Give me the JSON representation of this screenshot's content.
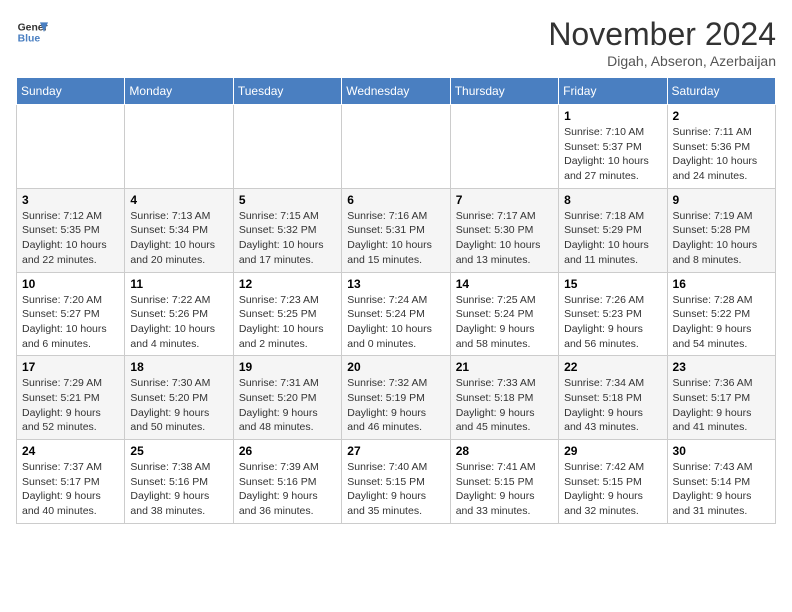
{
  "header": {
    "logo_line1": "General",
    "logo_line2": "Blue",
    "month": "November 2024",
    "location": "Digah, Abseron, Azerbaijan"
  },
  "weekdays": [
    "Sunday",
    "Monday",
    "Tuesday",
    "Wednesday",
    "Thursday",
    "Friday",
    "Saturday"
  ],
  "weeks": [
    [
      {
        "day": "",
        "info": ""
      },
      {
        "day": "",
        "info": ""
      },
      {
        "day": "",
        "info": ""
      },
      {
        "day": "",
        "info": ""
      },
      {
        "day": "",
        "info": ""
      },
      {
        "day": "1",
        "info": "Sunrise: 7:10 AM\nSunset: 5:37 PM\nDaylight: 10 hours and 27 minutes."
      },
      {
        "day": "2",
        "info": "Sunrise: 7:11 AM\nSunset: 5:36 PM\nDaylight: 10 hours and 24 minutes."
      }
    ],
    [
      {
        "day": "3",
        "info": "Sunrise: 7:12 AM\nSunset: 5:35 PM\nDaylight: 10 hours and 22 minutes."
      },
      {
        "day": "4",
        "info": "Sunrise: 7:13 AM\nSunset: 5:34 PM\nDaylight: 10 hours and 20 minutes."
      },
      {
        "day": "5",
        "info": "Sunrise: 7:15 AM\nSunset: 5:32 PM\nDaylight: 10 hours and 17 minutes."
      },
      {
        "day": "6",
        "info": "Sunrise: 7:16 AM\nSunset: 5:31 PM\nDaylight: 10 hours and 15 minutes."
      },
      {
        "day": "7",
        "info": "Sunrise: 7:17 AM\nSunset: 5:30 PM\nDaylight: 10 hours and 13 minutes."
      },
      {
        "day": "8",
        "info": "Sunrise: 7:18 AM\nSunset: 5:29 PM\nDaylight: 10 hours and 11 minutes."
      },
      {
        "day": "9",
        "info": "Sunrise: 7:19 AM\nSunset: 5:28 PM\nDaylight: 10 hours and 8 minutes."
      }
    ],
    [
      {
        "day": "10",
        "info": "Sunrise: 7:20 AM\nSunset: 5:27 PM\nDaylight: 10 hours and 6 minutes."
      },
      {
        "day": "11",
        "info": "Sunrise: 7:22 AM\nSunset: 5:26 PM\nDaylight: 10 hours and 4 minutes."
      },
      {
        "day": "12",
        "info": "Sunrise: 7:23 AM\nSunset: 5:25 PM\nDaylight: 10 hours and 2 minutes."
      },
      {
        "day": "13",
        "info": "Sunrise: 7:24 AM\nSunset: 5:24 PM\nDaylight: 10 hours and 0 minutes."
      },
      {
        "day": "14",
        "info": "Sunrise: 7:25 AM\nSunset: 5:24 PM\nDaylight: 9 hours and 58 minutes."
      },
      {
        "day": "15",
        "info": "Sunrise: 7:26 AM\nSunset: 5:23 PM\nDaylight: 9 hours and 56 minutes."
      },
      {
        "day": "16",
        "info": "Sunrise: 7:28 AM\nSunset: 5:22 PM\nDaylight: 9 hours and 54 minutes."
      }
    ],
    [
      {
        "day": "17",
        "info": "Sunrise: 7:29 AM\nSunset: 5:21 PM\nDaylight: 9 hours and 52 minutes."
      },
      {
        "day": "18",
        "info": "Sunrise: 7:30 AM\nSunset: 5:20 PM\nDaylight: 9 hours and 50 minutes."
      },
      {
        "day": "19",
        "info": "Sunrise: 7:31 AM\nSunset: 5:20 PM\nDaylight: 9 hours and 48 minutes."
      },
      {
        "day": "20",
        "info": "Sunrise: 7:32 AM\nSunset: 5:19 PM\nDaylight: 9 hours and 46 minutes."
      },
      {
        "day": "21",
        "info": "Sunrise: 7:33 AM\nSunset: 5:18 PM\nDaylight: 9 hours and 45 minutes."
      },
      {
        "day": "22",
        "info": "Sunrise: 7:34 AM\nSunset: 5:18 PM\nDaylight: 9 hours and 43 minutes."
      },
      {
        "day": "23",
        "info": "Sunrise: 7:36 AM\nSunset: 5:17 PM\nDaylight: 9 hours and 41 minutes."
      }
    ],
    [
      {
        "day": "24",
        "info": "Sunrise: 7:37 AM\nSunset: 5:17 PM\nDaylight: 9 hours and 40 minutes."
      },
      {
        "day": "25",
        "info": "Sunrise: 7:38 AM\nSunset: 5:16 PM\nDaylight: 9 hours and 38 minutes."
      },
      {
        "day": "26",
        "info": "Sunrise: 7:39 AM\nSunset: 5:16 PM\nDaylight: 9 hours and 36 minutes."
      },
      {
        "day": "27",
        "info": "Sunrise: 7:40 AM\nSunset: 5:15 PM\nDaylight: 9 hours and 35 minutes."
      },
      {
        "day": "28",
        "info": "Sunrise: 7:41 AM\nSunset: 5:15 PM\nDaylight: 9 hours and 33 minutes."
      },
      {
        "day": "29",
        "info": "Sunrise: 7:42 AM\nSunset: 5:15 PM\nDaylight: 9 hours and 32 minutes."
      },
      {
        "day": "30",
        "info": "Sunrise: 7:43 AM\nSunset: 5:14 PM\nDaylight: 9 hours and 31 minutes."
      }
    ]
  ]
}
